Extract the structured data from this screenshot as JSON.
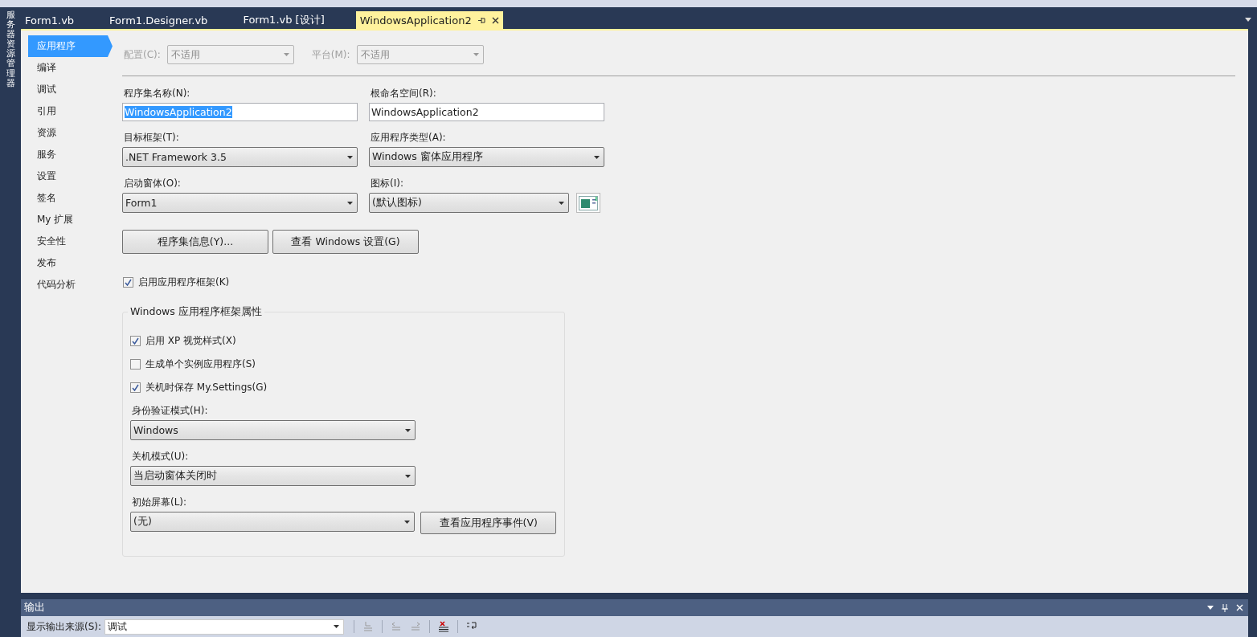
{
  "document_tabs": [
    {
      "label": "Form1.vb",
      "selected": false
    },
    {
      "label": "Form1.Designer.vb",
      "selected": false
    },
    {
      "label": "Form1.vb [设计]",
      "selected": false
    },
    {
      "label": "WindowsApplication2",
      "selected": true
    }
  ],
  "side_panel": {
    "title": "服务器资源管理器"
  },
  "nav": [
    {
      "label": "应用程序",
      "selected": true
    },
    {
      "label": "编译",
      "selected": false
    },
    {
      "label": "调试",
      "selected": false
    },
    {
      "label": "引用",
      "selected": false
    },
    {
      "label": "资源",
      "selected": false
    },
    {
      "label": "服务",
      "selected": false
    },
    {
      "label": "设置",
      "selected": false
    },
    {
      "label": "签名",
      "selected": false
    },
    {
      "label": "My 扩展",
      "selected": false
    },
    {
      "label": "安全性",
      "selected": false
    },
    {
      "label": "发布",
      "selected": false
    },
    {
      "label": "代码分析",
      "selected": false
    }
  ],
  "config_bar": [
    {
      "label": "配置(C):",
      "value": "不适用",
      "disabled": true
    },
    {
      "label": "平台(M):",
      "value": "不适用",
      "disabled": true
    }
  ],
  "fields": [
    {
      "kind": "text",
      "label": "程序集名称(N):",
      "value": "WindowsApplication2",
      "text_selected": true
    },
    {
      "kind": "text",
      "label": "根命名空间(R):",
      "value": "WindowsApplication2",
      "text_selected": false
    },
    {
      "kind": "select",
      "label": "目标框架(T):",
      "value": ".NET Framework 3.5"
    },
    {
      "kind": "select",
      "label": "应用程序类型(A):",
      "value": "Windows 窗体应用程序"
    },
    {
      "kind": "select",
      "label": "启动窗体(O):",
      "value": "Form1"
    },
    {
      "kind": "icon_select",
      "label": "图标(I):",
      "value": "(默认图标)"
    }
  ],
  "buttons": [
    "程序集信息(Y)...",
    "查看 Windows 设置(G)"
  ],
  "enable_framework": {
    "label": "启用应用程序框架(K)",
    "checked": true
  },
  "framework_group": {
    "title": "Windows 应用程序框架属性",
    "checkboxes": [
      {
        "label": "启用 XP 视觉样式(X)",
        "checked": true
      },
      {
        "label": "生成单个实例应用程序(S)",
        "checked": false
      },
      {
        "label": "关机时保存 My.Settings(G)",
        "checked": true
      }
    ],
    "selects": [
      {
        "label": "身份验证模式(H):",
        "value": "Windows"
      },
      {
        "label": "关机模式(U):",
        "value": "当启动窗体关闭时"
      },
      {
        "label": "初始屏幕(L):",
        "value": "(无)"
      }
    ],
    "event_button": "查看应用程序事件(V)"
  },
  "output": {
    "title": "输出",
    "source_label": "显示输出来源(S):",
    "source_value": "调试"
  }
}
